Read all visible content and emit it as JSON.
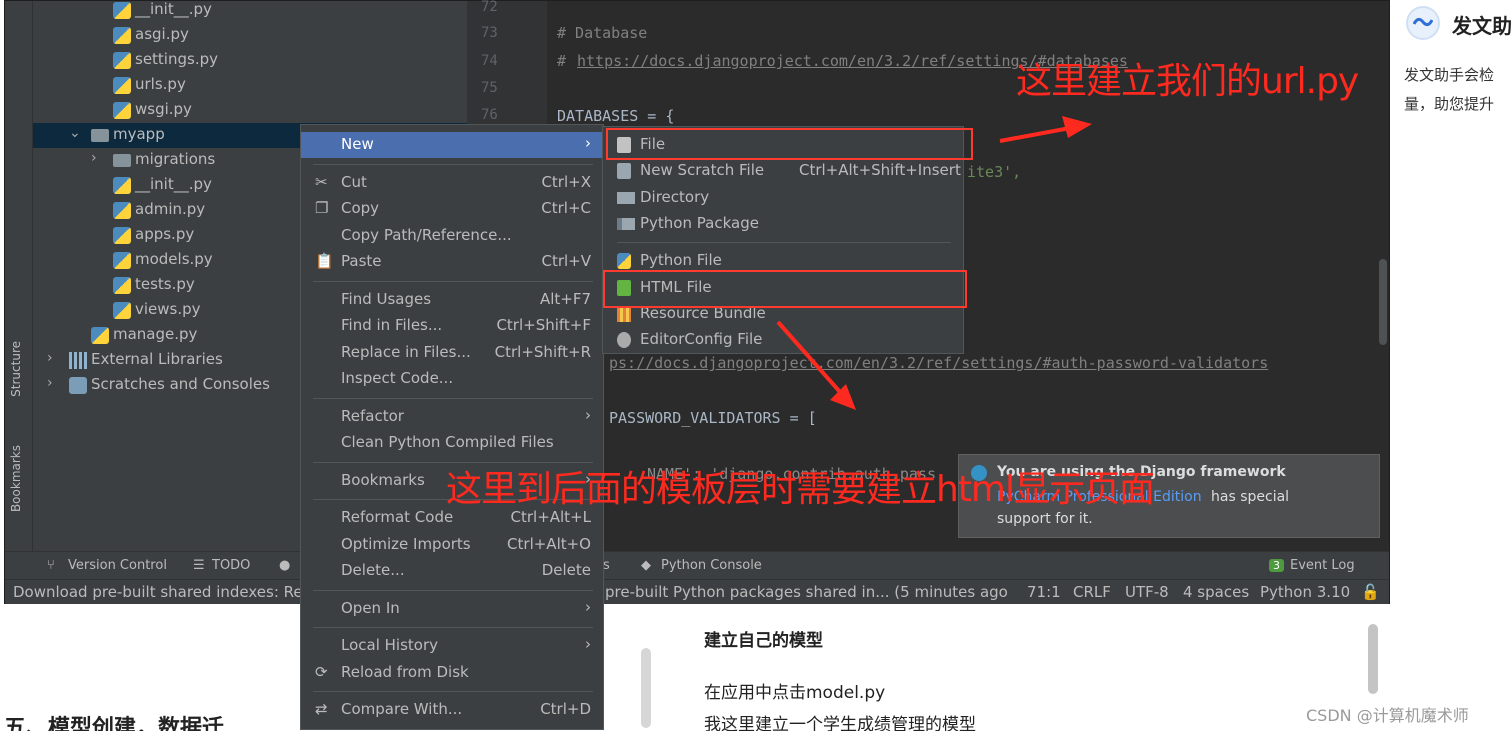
{
  "assistant": {
    "title": "发文助",
    "line1": "发文助手会检",
    "line2": "量，助您提升"
  },
  "project_tree": [
    {
      "name": "__init__.py",
      "type": "py",
      "indent": 2
    },
    {
      "name": "asgi.py",
      "type": "py",
      "indent": 2
    },
    {
      "name": "settings.py",
      "type": "py",
      "indent": 2
    },
    {
      "name": "urls.py",
      "type": "py",
      "indent": 2
    },
    {
      "name": "wsgi.py",
      "type": "py",
      "indent": 2
    },
    {
      "name": "myapp",
      "type": "folder",
      "indent": 1,
      "expanded": true,
      "selected": true
    },
    {
      "name": "migrations",
      "type": "folder",
      "indent": 2,
      "expanded": false
    },
    {
      "name": "__init__.py",
      "type": "py",
      "indent": 2
    },
    {
      "name": "admin.py",
      "type": "py",
      "indent": 2
    },
    {
      "name": "apps.py",
      "type": "py",
      "indent": 2
    },
    {
      "name": "models.py",
      "type": "py",
      "indent": 2
    },
    {
      "name": "tests.py",
      "type": "py",
      "indent": 2
    },
    {
      "name": "views.py",
      "type": "py",
      "indent": 2
    },
    {
      "name": "manage.py",
      "type": "py",
      "indent": 1
    },
    {
      "name": "External Libraries",
      "type": "lib",
      "indent": 0,
      "expanded": false
    },
    {
      "name": "Scratches and Consoles",
      "type": "scratch",
      "indent": 0,
      "expanded": false
    }
  ],
  "side_tabs": {
    "structure": "Structure",
    "bookmarks": "Bookmarks"
  },
  "editor": {
    "line_numbers": [
      "72",
      "73",
      "74",
      "75",
      "76"
    ],
    "comment_database": "# Database",
    "comment_hash": "# ",
    "db_link": "https://docs.djangoproject.com/en/3.2/ref/settings/#databases",
    "databases_line": "DATABASES = {",
    "sqlite_fragment": "ite3',",
    "auth_link": "ps://docs.djangoproject.com/en/3.2/ref/settings/#auth-password-validators",
    "validators_line": "PASSWORD_VALIDATORS = [",
    "name_fragment": "NAME': 'django.contrib.auth.pass"
  },
  "context_menu": [
    {
      "label": "New",
      "submenu": true,
      "highlighted": true
    },
    {
      "sep": true
    },
    {
      "label": "Cut",
      "shortcut": "Ctrl+X",
      "icon": "✂"
    },
    {
      "label": "Copy",
      "shortcut": "Ctrl+C",
      "icon": "❐"
    },
    {
      "label": "Copy Path/Reference..."
    },
    {
      "label": "Paste",
      "shortcut": "Ctrl+V",
      "icon": "📋"
    },
    {
      "sep": true
    },
    {
      "label": "Find Usages",
      "shortcut": "Alt+F7"
    },
    {
      "label": "Find in Files...",
      "shortcut": "Ctrl+Shift+F"
    },
    {
      "label": "Replace in Files...",
      "shortcut": "Ctrl+Shift+R"
    },
    {
      "label": "Inspect Code..."
    },
    {
      "sep": true
    },
    {
      "label": "Refactor",
      "submenu": true
    },
    {
      "label": "Clean Python Compiled Files"
    },
    {
      "sep": true
    },
    {
      "label": "Bookmarks",
      "submenu": true
    },
    {
      "sep": true
    },
    {
      "label": "Reformat Code",
      "shortcut": "Ctrl+Alt+L"
    },
    {
      "label": "Optimize Imports",
      "shortcut": "Ctrl+Alt+O"
    },
    {
      "label": "Delete...",
      "shortcut": "Delete"
    },
    {
      "sep": true
    },
    {
      "label": "Open In",
      "submenu": true
    },
    {
      "sep": true
    },
    {
      "label": "Local History",
      "submenu": true
    },
    {
      "label": "Reload from Disk",
      "icon": "⟳"
    },
    {
      "sep": true
    },
    {
      "label": "Compare With...",
      "shortcut": "Ctrl+D",
      "icon": "⇄"
    }
  ],
  "new_submenu": [
    {
      "label": "File",
      "icon": "file"
    },
    {
      "label": "New Scratch File",
      "shortcut": "Ctrl+Alt+Shift+Insert",
      "icon": "scratch"
    },
    {
      "label": "Directory",
      "icon": "dir"
    },
    {
      "label": "Python Package",
      "icon": "pkg"
    },
    {
      "sep": true
    },
    {
      "label": "Python File",
      "icon": "pyf"
    },
    {
      "label": "HTML File",
      "icon": "html"
    },
    {
      "label": "Resource Bundle",
      "icon": "res"
    },
    {
      "label": "EditorConfig File",
      "icon": "ec"
    }
  ],
  "bottom_tabs": {
    "version_control": "Version Control",
    "todo": "TODO",
    "python_console": "Python Console",
    "event_log": "Event Log",
    "event_count": "3",
    "partial_s": "s"
  },
  "status": {
    "left": "Download pre-built shared indexes: Rec",
    "middle": "pre-built Python packages shared in... (5 minutes ago",
    "position": "71:1",
    "line_sep": "CRLF",
    "encoding": "UTF-8",
    "indent": "4 spaces",
    "interpreter": "Python 3.10"
  },
  "notification": {
    "title": "You are using the Django framework",
    "link": "PyCharm Professional Edition",
    "rest": "has special",
    "line2": "support for it."
  },
  "annotations": {
    "url": "这里建立我们的url.py",
    "html": "这里到后面的模板层时需要建立html显示页面"
  },
  "article": {
    "left_heading": "五、模型创建，数据迁",
    "heading": "建立自己的模型",
    "p1": "在应用中点击model.py",
    "p2": "我这里建立一个学生成绩管理的模型",
    "watermark": "CSDN @计算机魔术师"
  },
  "colors": {
    "annotation": "#ff2a1f",
    "highlight": "#4b6eaf",
    "selected_row": "#0d293e"
  }
}
